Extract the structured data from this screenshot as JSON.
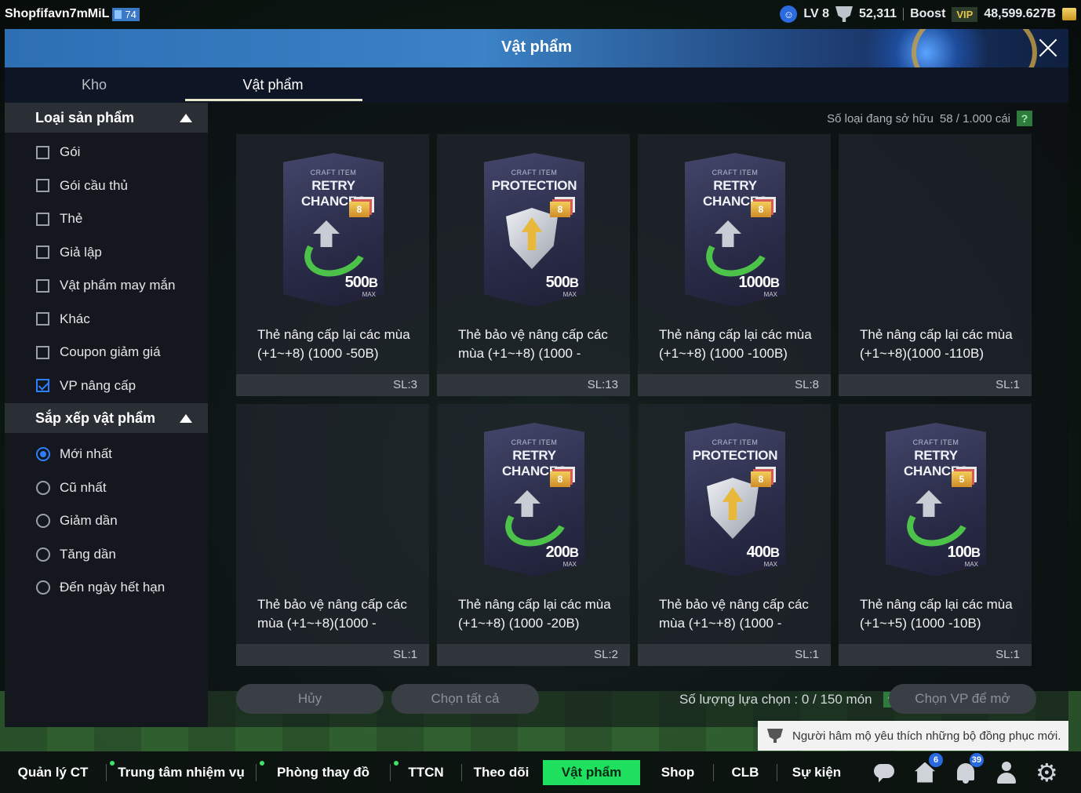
{
  "topbar": {
    "player_name": "Shopfifavn7mMiL",
    "account_level": "74",
    "lv_label": "LV 8",
    "trophies": "52,311",
    "boost_label": "Boost",
    "vip_label": "VIP",
    "coins": "48,599.627B"
  },
  "modal": {
    "title": "Vật phẩm",
    "tabs": [
      {
        "label": "Kho",
        "active": false
      },
      {
        "label": "Vật phẩm",
        "active": true
      }
    ]
  },
  "filters": {
    "category_header": "Loại sản phẩm",
    "categories": [
      {
        "label": "Gói",
        "checked": false
      },
      {
        "label": "Gói cầu thủ",
        "checked": false
      },
      {
        "label": "Thẻ",
        "checked": false
      },
      {
        "label": "Giả lập",
        "checked": false
      },
      {
        "label": "Vật phẩm may mắn",
        "checked": false
      },
      {
        "label": "Khác",
        "checked": false
      },
      {
        "label": "Coupon giảm giá",
        "checked": false
      },
      {
        "label": "VP nâng cấp",
        "checked": true
      }
    ],
    "sort_header": "Sắp xếp vật phẩm",
    "sorts": [
      {
        "label": "Mới nhất",
        "checked": true
      },
      {
        "label": "Cũ nhất",
        "checked": false
      },
      {
        "label": "Giảm dần",
        "checked": false
      },
      {
        "label": "Tăng dần",
        "checked": false
      },
      {
        "label": "Đến ngày hết hạn",
        "checked": false
      }
    ]
  },
  "owned": {
    "label": "Số loại đang sở hữu",
    "value": "58 / 1.000 cái",
    "help": "?"
  },
  "items": [
    {
      "card_sub": "CRAFT ITEM",
      "card_name": "RETRY CHANCES",
      "icon": "retry-icon",
      "level": "8",
      "value": "500",
      "unit": "B",
      "max": "MAX",
      "name": "Thẻ nâng cấp lại các mùa (+1~+8) (1000 -50B)",
      "qty": "SL:3",
      "show_card": true
    },
    {
      "card_sub": "CRAFT ITEM",
      "card_name": "PROTECTION",
      "icon": "shield-icon",
      "level": "8",
      "value": "500",
      "unit": "B",
      "max": "MAX",
      "name": "Thẻ bảo vệ nâng cấp các mùa (+1~+8) (1000 -",
      "qty": "SL:13",
      "show_card": true
    },
    {
      "card_sub": "CRAFT ITEM",
      "card_name": "RETRY CHANCES",
      "icon": "retry-icon",
      "level": "8",
      "value": "1000",
      "unit": "B",
      "max": "MAX",
      "name": "Thẻ nâng cấp lại các mùa (+1~+8) (1000 -100B)",
      "qty": "SL:8",
      "show_card": true
    },
    {
      "card_sub": "",
      "card_name": "",
      "icon": "",
      "level": "",
      "value": "",
      "unit": "",
      "max": "",
      "name": "Thẻ nâng cấp lại các mùa (+1~+8)(1000 -110B)",
      "qty": "SL:1",
      "show_card": false
    },
    {
      "card_sub": "",
      "card_name": "",
      "icon": "",
      "level": "",
      "value": "",
      "unit": "",
      "max": "",
      "name": "Thẻ bảo vệ nâng cấp các mùa (+1~+8)(1000 -",
      "qty": "SL:1",
      "show_card": false
    },
    {
      "card_sub": "CRAFT ITEM",
      "card_name": "RETRY CHANCES",
      "icon": "retry-icon",
      "level": "8",
      "value": "200",
      "unit": "B",
      "max": "MAX",
      "name": "Thẻ nâng cấp lại các mùa (+1~+8) (1000 -20B)",
      "qty": "SL:2",
      "show_card": true
    },
    {
      "card_sub": "CRAFT ITEM",
      "card_name": "PROTECTION",
      "icon": "shield-icon",
      "level": "8",
      "value": "400",
      "unit": "B",
      "max": "MAX",
      "name": "Thẻ bảo vệ nâng cấp các mùa (+1~+8) (1000 -",
      "qty": "SL:1",
      "show_card": true
    },
    {
      "card_sub": "CRAFT ITEM",
      "card_name": "RETRY CHANCES",
      "icon": "retry-icon",
      "level": "5",
      "value": "100",
      "unit": "B",
      "max": "MAX",
      "name": "Thẻ nâng cấp lại các mùa (+1~+5) (1000 -10B)",
      "qty": "SL:1",
      "show_card": true
    }
  ],
  "actions": {
    "cancel": "Hủy",
    "select_all": "Chọn tất cả",
    "selection_label": "Số lượng lựa chọn : 0 / 150 món",
    "help": "?",
    "open": "Chọn VP để mở"
  },
  "notice": {
    "text": "Người hâm mộ yêu thích những bộ đồng phục mới."
  },
  "bottom_nav": {
    "items": [
      {
        "label": "Quản lý CT",
        "dot": false,
        "active": false
      },
      {
        "label": "Trung tâm nhiệm vụ",
        "dot": true,
        "active": false
      },
      {
        "label": "Phòng thay đồ",
        "dot": true,
        "active": false
      },
      {
        "label": "TTCN",
        "dot": true,
        "active": false
      },
      {
        "label": "Theo dõi",
        "dot": false,
        "active": false
      },
      {
        "label": "Vật phẩm",
        "dot": false,
        "active": true
      },
      {
        "label": "Shop",
        "dot": false,
        "active": false
      },
      {
        "label": "CLB",
        "dot": false,
        "active": false
      },
      {
        "label": "Sự kiện",
        "dot": false,
        "active": false
      }
    ],
    "home_badge": "6",
    "bell_badge": "39"
  },
  "colors": {
    "accent_green": "#1fe05f",
    "checkbox_blue": "#2d7ff9",
    "title_blue": "#3b82c6"
  }
}
